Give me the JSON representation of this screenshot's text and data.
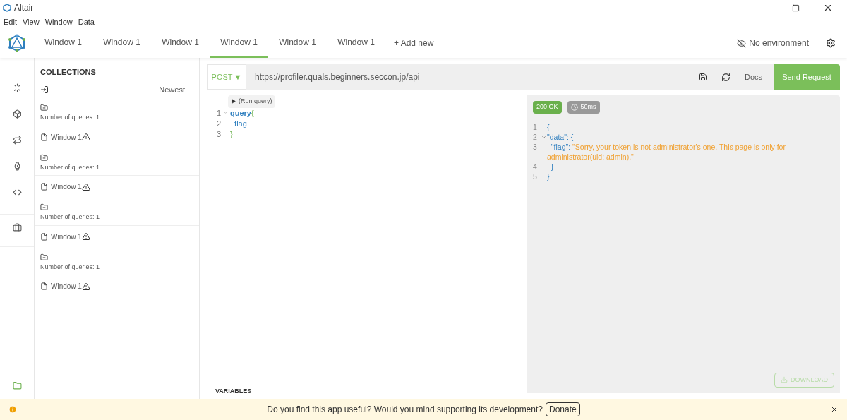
{
  "window": {
    "title": "Altair"
  },
  "menu": [
    "Edit",
    "View",
    "Window",
    "Data"
  ],
  "tabs": [
    {
      "label": "Window 1",
      "selected": false
    },
    {
      "label": "Window 1",
      "selected": false
    },
    {
      "label": "Window 1",
      "selected": false
    },
    {
      "label": "Window 1",
      "selected": true
    },
    {
      "label": "Window 1",
      "selected": false
    },
    {
      "label": "Window 1",
      "selected": false
    }
  ],
  "add_tab": "+ Add new",
  "environment": "No environment",
  "collections": {
    "title": "COLLECTIONS",
    "sort": "Newest",
    "items": [
      {
        "kind": "collection",
        "meta": "Number of queries: 1"
      },
      {
        "kind": "query",
        "label": "Window 1"
      },
      {
        "kind": "collection",
        "meta": "Number of queries: 1"
      },
      {
        "kind": "query",
        "label": "Window 1"
      },
      {
        "kind": "collection",
        "meta": "Number of queries: 1"
      },
      {
        "kind": "query",
        "label": "Window 1"
      },
      {
        "kind": "collection",
        "meta": "Number of queries: 1"
      },
      {
        "kind": "query",
        "label": "Window 1"
      }
    ]
  },
  "request": {
    "method": "POST",
    "method_caret": "▼",
    "url": "https://profiler.quals.beginners.seccon.jp/api",
    "docs": "Docs",
    "send": "Send Request"
  },
  "editor": {
    "run": "(Run query)",
    "lines": [
      {
        "number": "1",
        "text": "query",
        "brace": "{",
        "foldable": true
      },
      {
        "number": "2",
        "text": "  flag",
        "foldable": false
      },
      {
        "number": "3",
        "brace": "}",
        "foldable": false
      }
    ]
  },
  "response": {
    "status": "200 OK",
    "time": "50ms",
    "lines": [
      {
        "number": "1",
        "text": "{",
        "foldable": false
      },
      {
        "number": "2",
        "key": "\"data\"",
        "text": ": {",
        "foldable": true
      },
      {
        "number": "3",
        "key": "  \"flag\"",
        "text": ": ",
        "value": "\"Sorry, your token is not administrator's one. This page is only for administrator(uid: admin).\"",
        "foldable": false
      },
      {
        "number": "4",
        "text": "  }",
        "foldable": false
      },
      {
        "number": "5",
        "text": "}",
        "foldable": false
      }
    ],
    "download": "DOWNLOAD"
  },
  "variables": "VARIABLES",
  "banner": {
    "message": "Do you find this app useful? Would you mind supporting its development?",
    "donate": "Donate"
  }
}
